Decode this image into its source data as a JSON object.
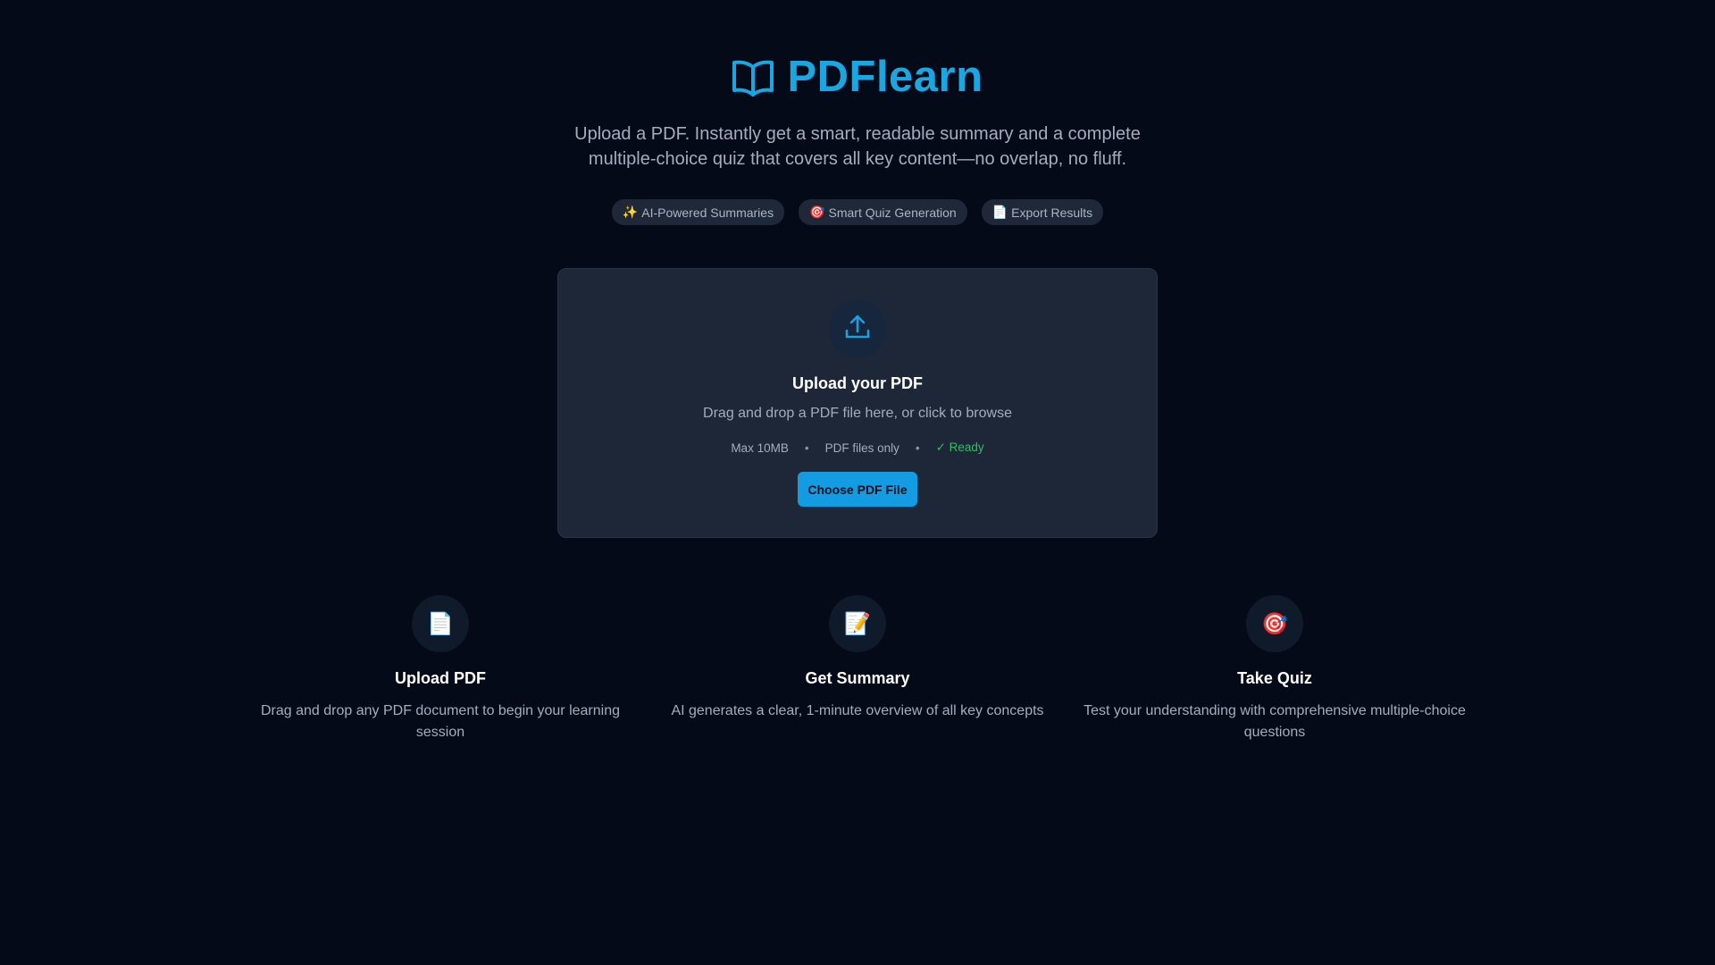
{
  "header": {
    "title": "PDFlearn",
    "tagline_line1": "Upload a PDF. Instantly get a smart, readable summary and a complete",
    "tagline_line2": "multiple-choice quiz that covers all key content—no overlap, no fluff.",
    "brand_color": "#1aa6e0"
  },
  "chips": [
    {
      "icon": "✨",
      "label": "AI-Powered Summaries"
    },
    {
      "icon": "🎯",
      "label": "Smart Quiz Generation"
    },
    {
      "icon": "📄",
      "label": "Export Results"
    }
  ],
  "upload": {
    "title": "Upload your PDF",
    "subtitle": "Drag and drop a PDF file here, or click to browse",
    "max_size": "Max 10MB",
    "separator": "•",
    "file_type": "PDF files only",
    "status": "✓ Ready",
    "button_label": "Choose PDF File",
    "accent_color": "#139ce2",
    "status_color": "#2fbf62"
  },
  "steps": [
    {
      "icon": "📄",
      "title": "Upload PDF",
      "desc": "Drag and drop any PDF document to begin your learning session"
    },
    {
      "icon": "📝",
      "title": "Get Summary",
      "desc": "AI generates a clear, 1-minute overview of all key concepts"
    },
    {
      "icon": "🎯",
      "title": "Take Quiz",
      "desc": "Test your understanding with comprehensive multiple-choice questions"
    }
  ]
}
